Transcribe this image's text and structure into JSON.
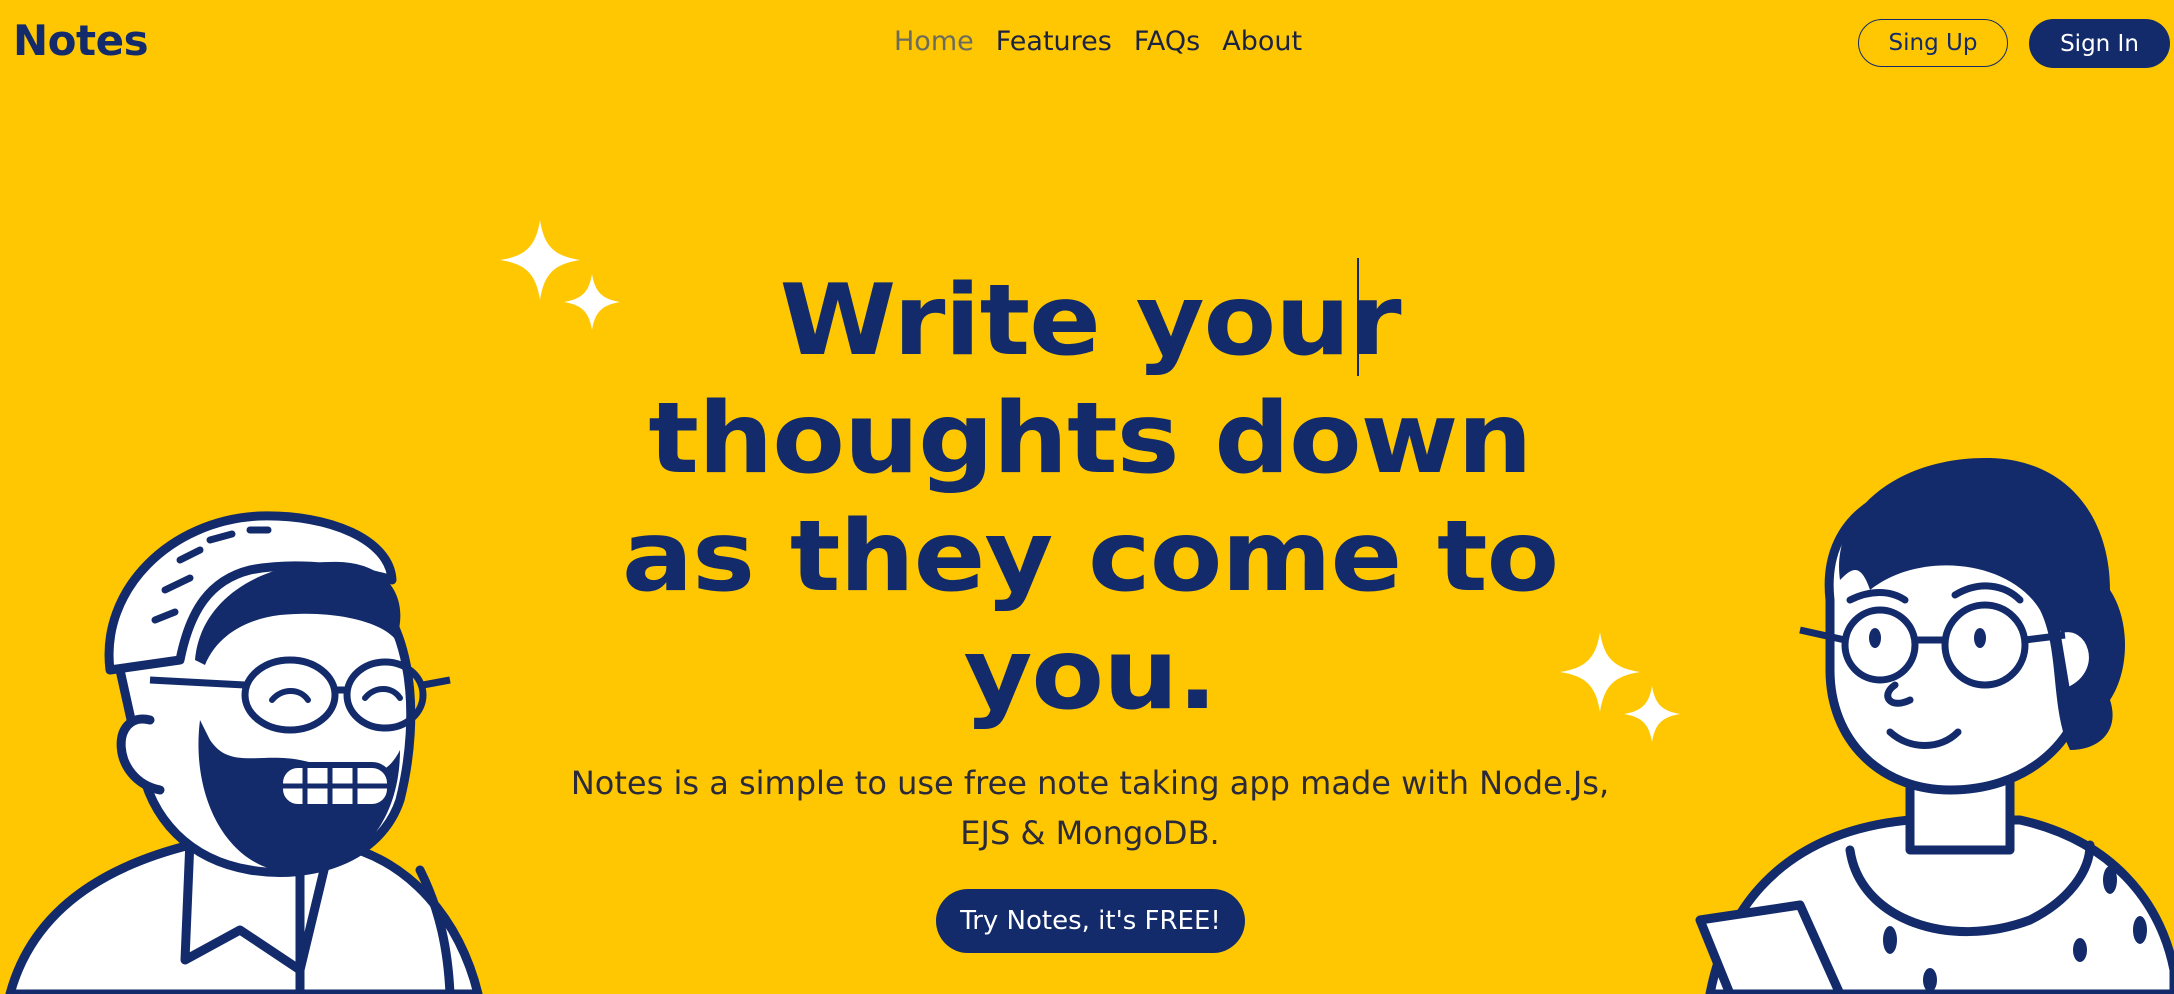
{
  "header": {
    "logo": "Notes",
    "nav": [
      {
        "label": "Home",
        "active": true
      },
      {
        "label": "Features",
        "active": false
      },
      {
        "label": "FAQs",
        "active": false
      },
      {
        "label": "About",
        "active": false
      }
    ],
    "signup_label": "Sing Up",
    "signin_label": "Sign In"
  },
  "hero": {
    "title_lines": [
      "Write your",
      "thoughts down",
      "as they come to",
      "you."
    ],
    "description_lines": [
      "Notes is a simple to use free note taking app made with Node.Js,",
      "EJS & MongoDB."
    ],
    "cta_label": "Try Notes, it's FREE!"
  },
  "colors": {
    "background": "#FEC702",
    "primary": "#132B6A",
    "text": "#2A2A3A",
    "white": "#FFFFFF"
  },
  "icons": [
    "sparkle-icon",
    "man-illustration",
    "woman-illustration"
  ]
}
